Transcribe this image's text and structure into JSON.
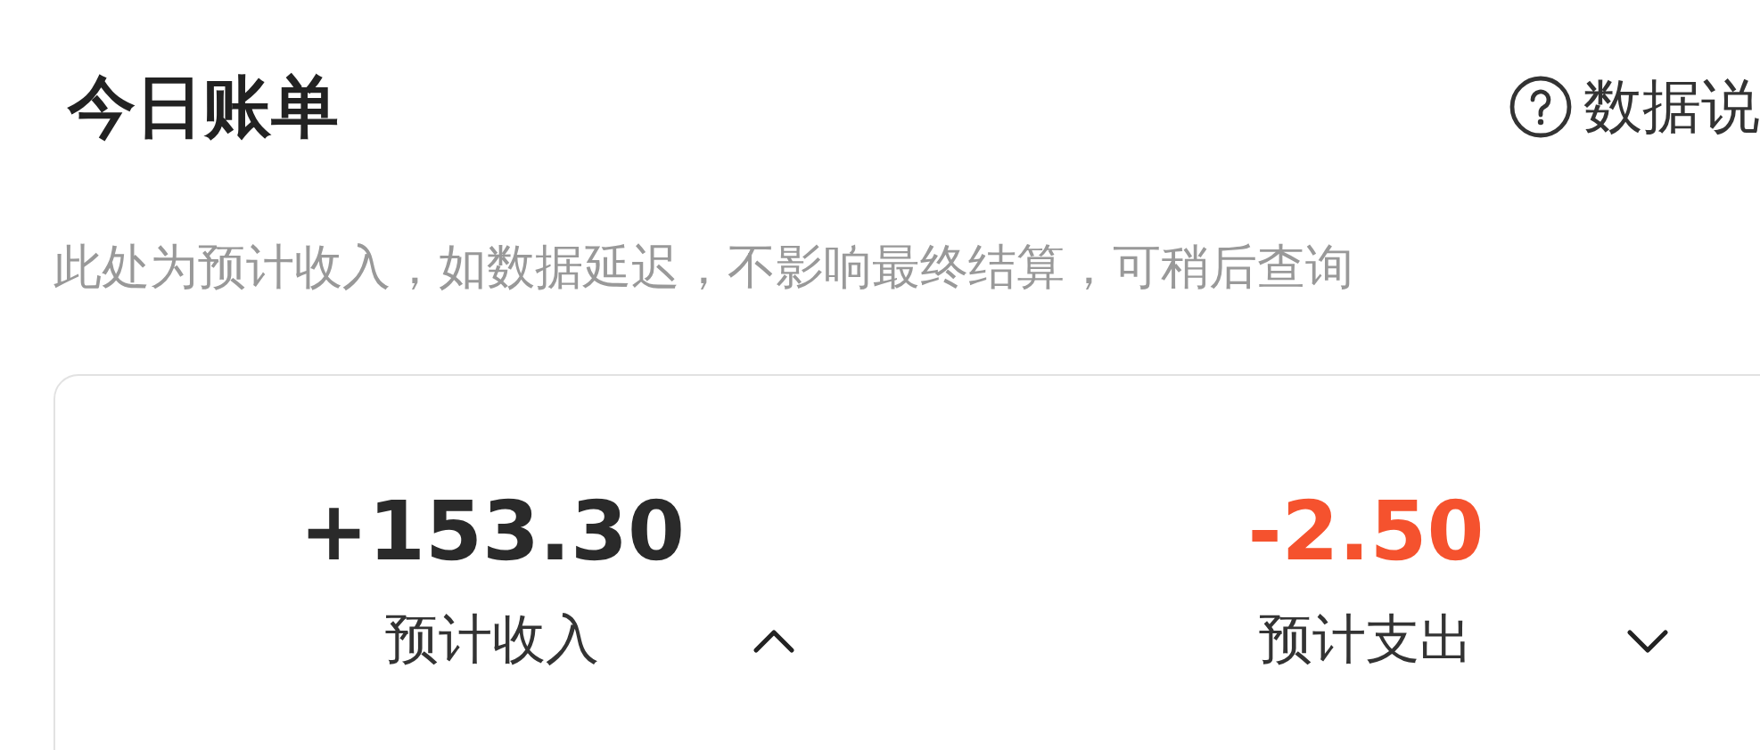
{
  "header": {
    "title": "今日账单",
    "help_link": "数据说"
  },
  "notice": "此处为预计收入，如数据延迟，不影响最终结算，可稍后查询",
  "summary": [
    {
      "kind": "income",
      "amount": "+153.30",
      "label": "预计收入",
      "expanded": true
    },
    {
      "kind": "expense",
      "amount": "-2.50",
      "label": "预计支出",
      "expanded": false
    }
  ]
}
